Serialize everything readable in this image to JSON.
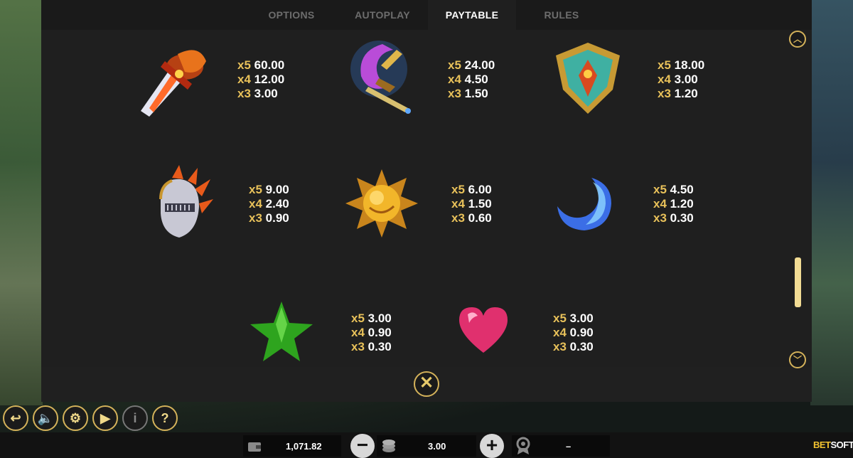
{
  "tabs": [
    {
      "label": "OPTIONS",
      "active": false
    },
    {
      "label": "AUTOPLAY",
      "active": false
    },
    {
      "label": "PAYTABLE",
      "active": true
    },
    {
      "label": "RULES",
      "active": false
    }
  ],
  "paytable": [
    {
      "symbol": "sword-icon",
      "pays": [
        {
          "mult": "x5",
          "value": "60.00"
        },
        {
          "mult": "x4",
          "value": "12.00"
        },
        {
          "mult": "x3",
          "value": "3.00"
        }
      ]
    },
    {
      "symbol": "staff-icon",
      "pays": [
        {
          "mult": "x5",
          "value": "24.00"
        },
        {
          "mult": "x4",
          "value": "4.50"
        },
        {
          "mult": "x3",
          "value": "1.50"
        }
      ]
    },
    {
      "symbol": "shield-icon",
      "pays": [
        {
          "mult": "x5",
          "value": "18.00"
        },
        {
          "mult": "x4",
          "value": "3.00"
        },
        {
          "mult": "x3",
          "value": "1.20"
        }
      ]
    },
    {
      "symbol": "helmet-icon",
      "pays": [
        {
          "mult": "x5",
          "value": "9.00"
        },
        {
          "mult": "x4",
          "value": "2.40"
        },
        {
          "mult": "x3",
          "value": "0.90"
        }
      ]
    },
    {
      "symbol": "sun-icon",
      "pays": [
        {
          "mult": "x5",
          "value": "6.00"
        },
        {
          "mult": "x4",
          "value": "1.50"
        },
        {
          "mult": "x3",
          "value": "0.60"
        }
      ]
    },
    {
      "symbol": "moon-icon",
      "pays": [
        {
          "mult": "x5",
          "value": "4.50"
        },
        {
          "mult": "x4",
          "value": "1.20"
        },
        {
          "mult": "x3",
          "value": "0.30"
        }
      ]
    },
    {
      "symbol": "star-icon",
      "pays": [
        {
          "mult": "x5",
          "value": "3.00"
        },
        {
          "mult": "x4",
          "value": "0.90"
        },
        {
          "mult": "x3",
          "value": "0.30"
        }
      ]
    },
    {
      "symbol": "heart-icon",
      "pays": [
        {
          "mult": "x5",
          "value": "3.00"
        },
        {
          "mult": "x4",
          "value": "0.90"
        },
        {
          "mult": "x3",
          "value": "0.30"
        }
      ]
    }
  ],
  "controls": {
    "back": "back-icon",
    "sound": "sound-icon",
    "settings": "gear-icon",
    "autoplay": "autoplay-icon",
    "info": "info-icon",
    "help": "help-icon"
  },
  "footer": {
    "balance": "1,071.82",
    "bet": "3.00",
    "win": "–",
    "logo_prefix": "BET",
    "logo_suffix": "SOFT"
  },
  "colors": {
    "accent": "#d4b25a",
    "multiplier": "#e8c15a",
    "panel": "#1f1f1f"
  }
}
